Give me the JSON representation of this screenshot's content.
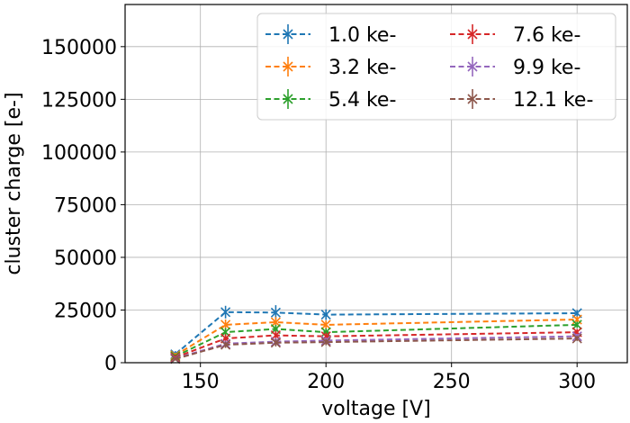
{
  "chart_data": {
    "type": "line",
    "xlabel": "voltage [V]",
    "ylabel": "cluster charge [e-]",
    "xlim": [
      120,
      320
    ],
    "ylim": [
      0,
      170000
    ],
    "x_ticks": [
      150,
      200,
      250,
      300
    ],
    "y_ticks": [
      0,
      25000,
      50000,
      75000,
      100000,
      125000,
      150000
    ],
    "grid": true,
    "legend": {
      "placement": "top-right",
      "columns": 2
    },
    "marker": "x",
    "line_style": "dashed",
    "series": [
      {
        "name": "1.0 ke-",
        "color": "#1f77b4",
        "x": [
          140,
          160,
          180,
          200,
          300
        ],
        "y": [
          4000,
          24000,
          23800,
          22800,
          23500
        ],
        "yerr": [
          1500,
          3000,
          3500,
          2500,
          1500
        ]
      },
      {
        "name": "3.2 ke-",
        "color": "#ff7f0e",
        "x": [
          140,
          160,
          180,
          200,
          300
        ],
        "y": [
          3500,
          18000,
          19200,
          18000,
          20500
        ],
        "yerr": [
          1200,
          2500,
          2500,
          2000,
          1500
        ]
      },
      {
        "name": "5.4 ke-",
        "color": "#2ca02c",
        "x": [
          140,
          160,
          180,
          200,
          300
        ],
        "y": [
          3000,
          14500,
          16000,
          14500,
          18000
        ],
        "yerr": [
          1000,
          2000,
          2000,
          1800,
          1500
        ]
      },
      {
        "name": "7.6 ke-",
        "color": "#d62728",
        "x": [
          140,
          160,
          180,
          200,
          300
        ],
        "y": [
          2500,
          11500,
          13000,
          12500,
          14500
        ],
        "yerr": [
          1000,
          2000,
          2000,
          1800,
          1500
        ]
      },
      {
        "name": "9.9 ke-",
        "color": "#9467bd",
        "x": [
          140,
          160,
          180,
          200,
          300
        ],
        "y": [
          2000,
          9000,
          10000,
          10500,
          12500
        ],
        "yerr": [
          800,
          1500,
          1800,
          1500,
          1200
        ]
      },
      {
        "name": "12.1 ke-",
        "color": "#8c564b",
        "x": [
          140,
          160,
          180,
          200,
          300
        ],
        "y": [
          1800,
          8500,
          9500,
          9800,
          11500
        ],
        "yerr": [
          800,
          1500,
          1800,
          1500,
          1200
        ]
      }
    ]
  }
}
